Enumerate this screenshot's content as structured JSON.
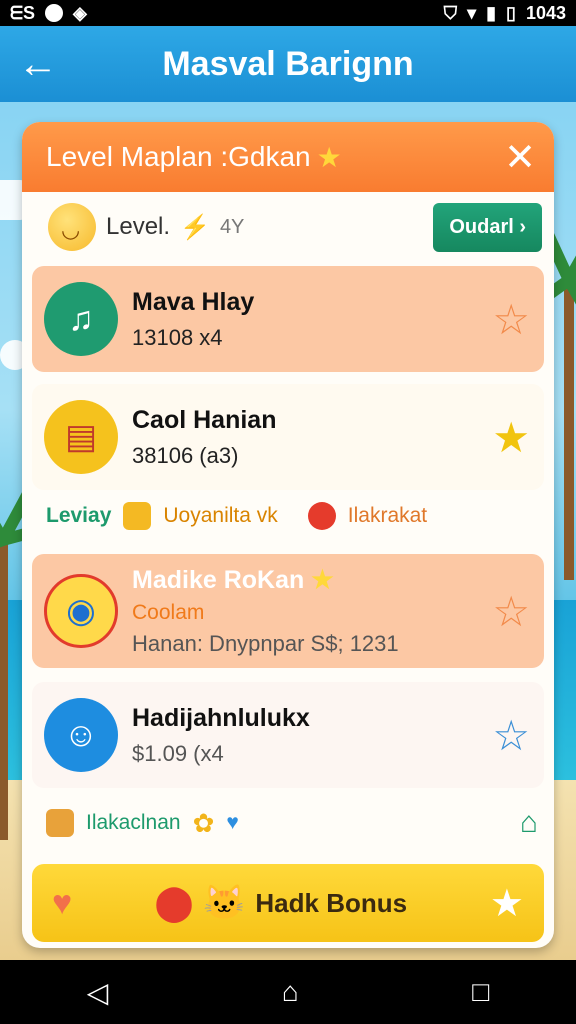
{
  "status": {
    "left_text": "ᗴS",
    "time": "1043"
  },
  "appbar": {
    "title": "Masval Barignn"
  },
  "card": {
    "title": "Level Maplan :Gdkan",
    "level_label": "Level.",
    "level_value": "4Y",
    "order_button": "Oudarl"
  },
  "items": [
    {
      "name": "Mava Hlay",
      "sub": "13108 x4",
      "bg": "#fcc8a4",
      "icon_color": "#1f9b70"
    },
    {
      "name": "Caol Hanian",
      "sub": "38106 (a3)",
      "bg": "#fffaf0",
      "icon_color": "#f5c21d"
    },
    {
      "name": "Madike RoKan",
      "tag": "Coolam",
      "sub": "Hanan: Dnypnpar S$; 1231",
      "bg": "#fcc8a4",
      "icon_color": "#ffd94a"
    },
    {
      "name": "Hadijahnlulukx",
      "sub": "$1.09 (x4",
      "bg": "#fdf6f2",
      "icon_color": "#1e8de0"
    }
  ],
  "links_row_1": {
    "a": "Leviay",
    "b": "Uoyanilta vk",
    "c": "Ilakrakat"
  },
  "links_row_2": {
    "a": "Ilakaclnan"
  },
  "bonus": {
    "label": "Hadk Bonus"
  },
  "colors": {
    "accent_orange": "#f97c30",
    "app_blue": "#1b8fd4",
    "green": "#16885f",
    "yellow": "#f6c317"
  }
}
